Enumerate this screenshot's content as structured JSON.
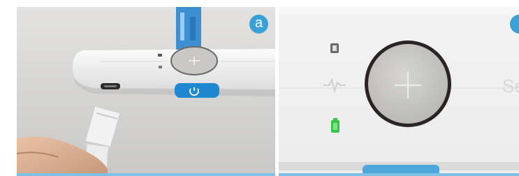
{
  "panels": [
    {
      "id": "a",
      "badge_label": "a",
      "button_label": "+",
      "power_symbol": "⏻"
    },
    {
      "id": "b",
      "badge_label": "",
      "button_label": "+",
      "partial_text": "Se"
    }
  ],
  "colors": {
    "accent_blue": "#3aa0d8",
    "power_button_blue": "#1e88d0",
    "battery_green": "#37c64a",
    "device_white": "#f4f4f4",
    "button_grey": "#c9c8c5"
  },
  "icons": {
    "panel_a": [
      "usb-c-port-icon",
      "status-led-icon",
      "power-icon",
      "plus-icon"
    ],
    "panel_b": [
      "bluetooth-status-icon",
      "heart-rate-icon",
      "battery-icon",
      "plus-icon"
    ]
  }
}
